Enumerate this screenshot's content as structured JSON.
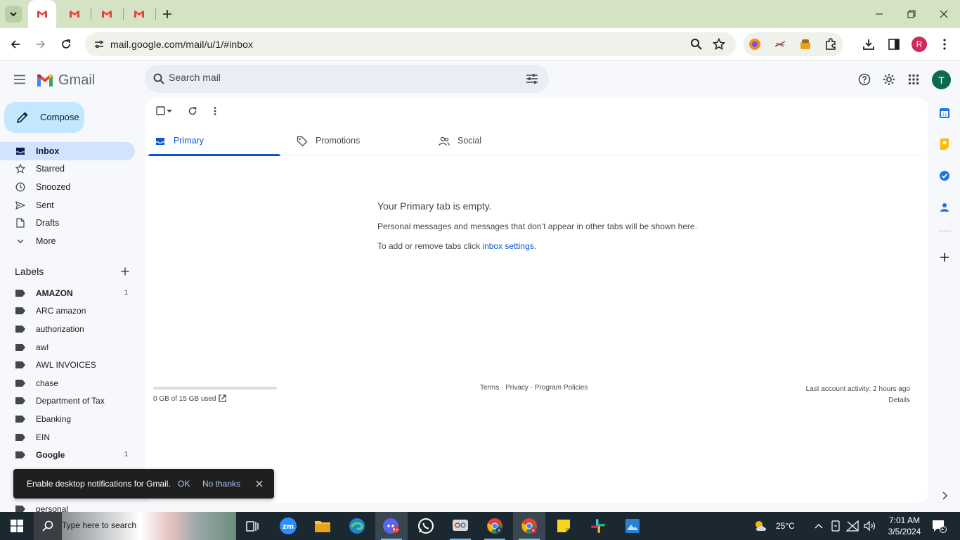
{
  "browser": {
    "tabs": [
      {
        "title": "Gmail",
        "active": true
      },
      {
        "title": "Gmail",
        "active": false
      },
      {
        "title": "Gmail",
        "active": false
      },
      {
        "title": "Gmail",
        "active": false
      }
    ],
    "url": "mail.google.com/mail/u/1/#inbox",
    "profile_initial": "R"
  },
  "gmail": {
    "logo_text": "Gmail",
    "search_placeholder": "Search mail",
    "account_initial": "T",
    "compose_label": "Compose",
    "nav": [
      {
        "label": "Inbox",
        "icon": "inbox-icon",
        "active": true
      },
      {
        "label": "Starred",
        "icon": "star-icon",
        "active": false
      },
      {
        "label": "Snoozed",
        "icon": "clock-icon",
        "active": false
      },
      {
        "label": "Sent",
        "icon": "send-icon",
        "active": false
      },
      {
        "label": "Drafts",
        "icon": "draft-icon",
        "active": false
      },
      {
        "label": "More",
        "icon": "chevron-down-icon",
        "active": false
      }
    ],
    "labels_heading": "Labels",
    "labels": [
      {
        "name": "AMAZON",
        "count": "1",
        "bold": true
      },
      {
        "name": "ARC amazon",
        "count": "",
        "bold": false
      },
      {
        "name": "authorization",
        "count": "",
        "bold": false
      },
      {
        "name": "awl",
        "count": "",
        "bold": false
      },
      {
        "name": "AWL INVOICES",
        "count": "",
        "bold": false
      },
      {
        "name": "chase",
        "count": "",
        "bold": false
      },
      {
        "name": "Department of Tax",
        "count": "",
        "bold": false
      },
      {
        "name": "Ebanking",
        "count": "",
        "bold": false
      },
      {
        "name": "EIN",
        "count": "",
        "bold": false
      },
      {
        "name": "Google",
        "count": "1",
        "bold": true
      },
      {
        "name": "personal",
        "count": "",
        "bold": false
      }
    ],
    "tabs": [
      {
        "label": "Primary",
        "icon": "inbox-icon",
        "active": true
      },
      {
        "label": "Promotions",
        "icon": "tag-icon",
        "active": false
      },
      {
        "label": "Social",
        "icon": "people-icon",
        "active": false
      }
    ],
    "empty": {
      "title": "Your Primary tab is empty.",
      "line1": "Personal messages and messages that don’t appear in other tabs will be shown here.",
      "line2_prefix": "To add or remove tabs click ",
      "line2_link": "inbox settings",
      "line2_suffix": "."
    },
    "storage": {
      "text": "0 GB of 15 GB used",
      "fraction": 0.0
    },
    "footer": "Terms · Privacy · Program Policies",
    "activity": {
      "line1": "Last account activity: 2 hours ago",
      "line2": "Details"
    },
    "toast": {
      "message": "Enable desktop notifications for Gmail.",
      "ok": "OK",
      "no": "No thanks"
    }
  },
  "taskbar": {
    "search_text": "Type here to search",
    "weather": "25°C",
    "time": "7:01 AM",
    "date": "3/5/2024",
    "notification_count": "1"
  },
  "colors": {
    "accent": "#0b57d0",
    "compose_bg": "#c2e7ff",
    "nav_active": "#d3e3fd",
    "tabstrip": "#d3e3c3"
  }
}
